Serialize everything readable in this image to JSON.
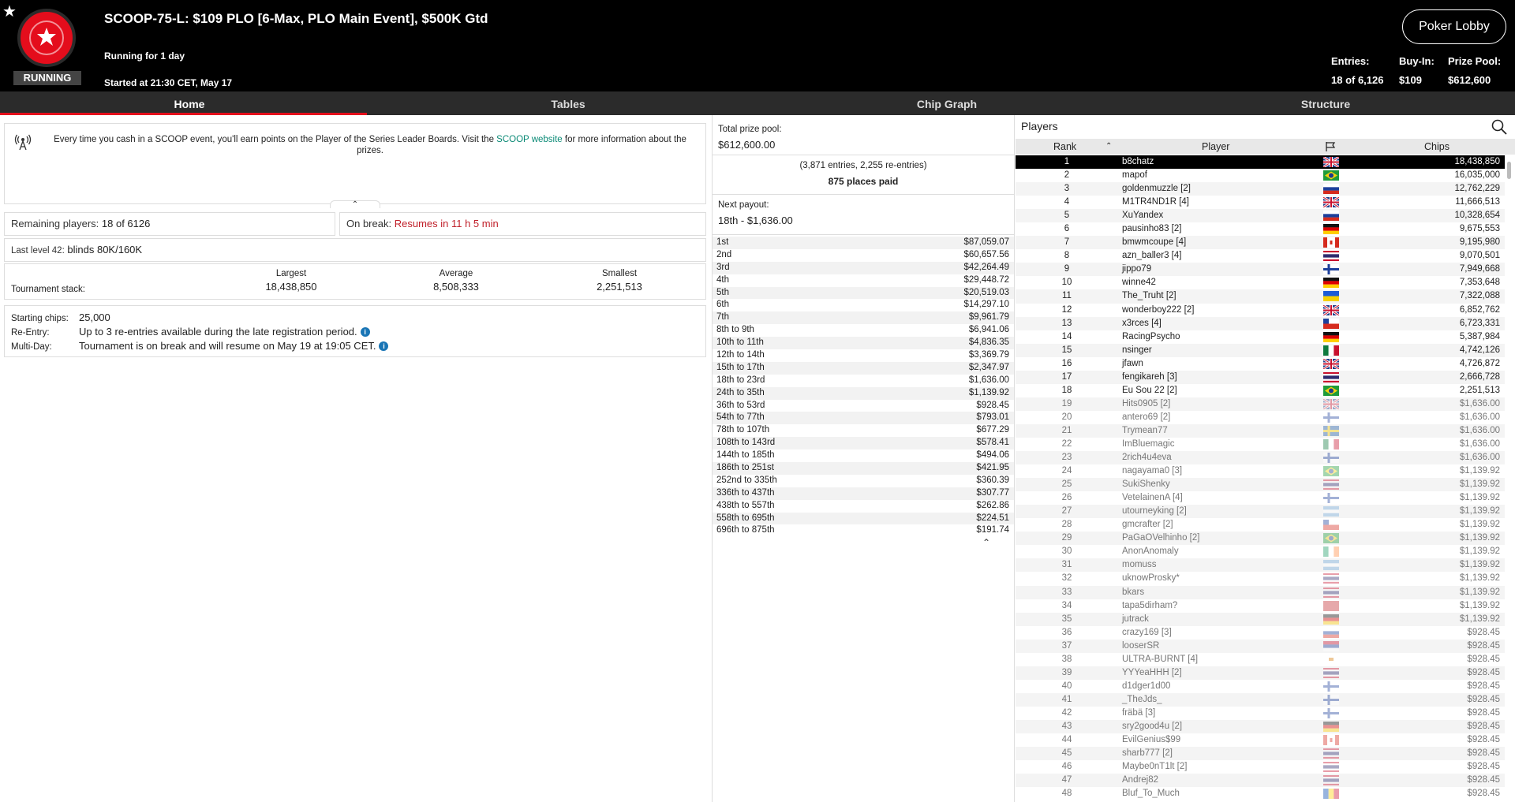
{
  "header": {
    "title": "SCOOP-75-L: $109 PLO [6-Max, PLO Main Event], $500K Gtd",
    "status_badge": "RUNNING",
    "running_for": "Running for 1 day",
    "started_at": "Started at 21:30 CET, May 17",
    "lobby_button": "Poker Lobby",
    "entries_label": "Entries:",
    "entries_value": "18 of 6,126",
    "buyin_label": "Buy-In:",
    "buyin_value": "$109",
    "prizepool_label": "Prize Pool:",
    "prizepool_value": "$612,600"
  },
  "tabs": [
    {
      "label": "Home",
      "active": true
    },
    {
      "label": "Tables",
      "active": false
    },
    {
      "label": "Chip Graph",
      "active": false
    },
    {
      "label": "Structure",
      "active": false
    }
  ],
  "home": {
    "info_text_before": "Every time you cash in a SCOOP event, you'll earn points on the Player of the Series Leader Boards. Visit the ",
    "info_link": "SCOOP website",
    "info_text_after": " for more information about the prizes.",
    "remaining_label": "Remaining players:",
    "remaining_value": "18 of 6126",
    "break_label": "On break:",
    "break_value": "Resumes in 11 h 5 min",
    "last_level_label": "Last level 42:",
    "last_level_value": "blinds 80K/160K",
    "stack_label": "Tournament stack:",
    "largest_label": "Largest",
    "largest_value": "18,438,850",
    "average_label": "Average",
    "average_value": "8,508,333",
    "smallest_label": "Smallest",
    "smallest_value": "2,251,513",
    "starting_chips_label": "Starting chips:",
    "starting_chips_value": "25,000",
    "reentry_label": "Re-Entry:",
    "reentry_value": "Up to 3 re-entries available during the late registration period.",
    "multiday_label": "Multi-Day:",
    "multiday_value": "Tournament is on break and will resume on May 19 at 19:05 CET."
  },
  "payouts": {
    "total_label": "Total prize pool:",
    "total_value": "$612,600.00",
    "entries_line": "(3,871 entries, 2,255 re-entries)",
    "places_paid": "875 places paid",
    "next_label": "Next payout:",
    "next_value": "18th - $1,636.00",
    "rows": [
      [
        "1st",
        "$87,059.07"
      ],
      [
        "2nd",
        "$60,657.56"
      ],
      [
        "3rd",
        "$42,264.49"
      ],
      [
        "4th",
        "$29,448.72"
      ],
      [
        "5th",
        "$20,519.03"
      ],
      [
        "6th",
        "$14,297.10"
      ],
      [
        "7th",
        "$9,961.79"
      ],
      [
        "8th to 9th",
        "$6,941.06"
      ],
      [
        "10th to 11th",
        "$4,836.35"
      ],
      [
        "12th to 14th",
        "$3,369.79"
      ],
      [
        "15th to 17th",
        "$2,347.97"
      ],
      [
        "18th to 23rd",
        "$1,636.00"
      ],
      [
        "24th to 35th",
        "$1,139.92"
      ],
      [
        "36th to 53rd",
        "$928.45"
      ],
      [
        "54th to 77th",
        "$793.01"
      ],
      [
        "78th to 107th",
        "$677.29"
      ],
      [
        "108th to 143rd",
        "$578.41"
      ],
      [
        "144th to 185th",
        "$494.06"
      ],
      [
        "186th to 251st",
        "$421.95"
      ],
      [
        "252nd to 335th",
        "$360.39"
      ],
      [
        "336th to 437th",
        "$307.77"
      ],
      [
        "438th to 557th",
        "$262.86"
      ],
      [
        "558th to 695th",
        "$224.51"
      ],
      [
        "696th to 875th",
        "$191.74"
      ]
    ]
  },
  "players": {
    "title": "Players",
    "col_rank": "Rank",
    "col_player": "Player",
    "col_chips": "Chips",
    "rows": [
      [
        1,
        "b8chatz",
        "uk",
        "18,438,850"
      ],
      [
        2,
        "mapof",
        "br",
        "16,035,000"
      ],
      [
        3,
        "goldenmuzzle [2]",
        "ru",
        "12,762,229"
      ],
      [
        4,
        "M1TR4ND1R [4]",
        "uk",
        "11,666,513"
      ],
      [
        5,
        "XuYandex",
        "ru",
        "10,328,654"
      ],
      [
        6,
        "pausinho83 [2]",
        "de",
        "9,675,553"
      ],
      [
        7,
        "bmwmcoupe [4]",
        "ca",
        "9,195,980"
      ],
      [
        8,
        "azn_baller3 [4]",
        "th",
        "9,070,501"
      ],
      [
        9,
        "jippo79",
        "fi",
        "7,949,668"
      ],
      [
        10,
        "winne42",
        "de",
        "7,353,648"
      ],
      [
        11,
        "The_Truht [2]",
        "ua",
        "7,322,088"
      ],
      [
        12,
        "wonderboy222 [2]",
        "uk",
        "6,852,762"
      ],
      [
        13,
        "x3rces [4]",
        "cl",
        "6,723,331"
      ],
      [
        14,
        "RacingPsycho",
        "de",
        "5,387,984"
      ],
      [
        15,
        "nsinger",
        "mx",
        "4,742,126"
      ],
      [
        16,
        "jfawn",
        "uk",
        "4,726,872"
      ],
      [
        17,
        "fengikareh [3]",
        "th",
        "2,666,728"
      ],
      [
        18,
        "Eu Sou 22 [2]",
        "br",
        "2,251,513"
      ],
      [
        19,
        "Hits0905 [2]",
        "uk",
        "$1,636.00"
      ],
      [
        20,
        "antero69 [2]",
        "fi",
        "$1,636.00"
      ],
      [
        21,
        "Trymean77",
        "se",
        "$1,636.00"
      ],
      [
        22,
        "ImBluemagic",
        "mx",
        "$1,636.00"
      ],
      [
        23,
        "2rich4u4eva",
        "fi",
        "$1,636.00"
      ],
      [
        24,
        "nagayama0 [3]",
        "br",
        "$1,139.92"
      ],
      [
        25,
        "SukiShenky",
        "th",
        "$1,139.92"
      ],
      [
        26,
        "VetelainenA [4]",
        "fi",
        "$1,139.92"
      ],
      [
        27,
        "utourneyking [2]",
        "ar",
        "$1,139.92"
      ],
      [
        28,
        "gmcrafter [2]",
        "cl",
        "$1,139.92"
      ],
      [
        29,
        "PaGaOVelhinho [2]",
        "br",
        "$1,139.92"
      ],
      [
        30,
        "AnonAnomaly",
        "ie",
        "$1,139.92"
      ],
      [
        31,
        "momuss",
        "ar",
        "$1,139.92"
      ],
      [
        32,
        "uknowProsky*",
        "th",
        "$1,139.92"
      ],
      [
        33,
        "bkars",
        "th",
        "$1,139.92"
      ],
      [
        34,
        "tapa5dirham?",
        "ma",
        "$1,139.92"
      ],
      [
        35,
        "jutrack",
        "de",
        "$1,139.92"
      ],
      [
        36,
        "crazy169 [3]",
        "sk",
        "$928.45"
      ],
      [
        37,
        "looserSR",
        "rs",
        "$928.45"
      ],
      [
        38,
        "ULTRA-BURNT [4]",
        "cy",
        "$928.45"
      ],
      [
        39,
        "YYYeaHHH [2]",
        "th",
        "$928.45"
      ],
      [
        40,
        "d1dger1d00",
        "fi",
        "$928.45"
      ],
      [
        41,
        "_TheJds_",
        "fi",
        "$928.45"
      ],
      [
        42,
        "fräbä [3]",
        "fi",
        "$928.45"
      ],
      [
        43,
        "sry2good4u [2]",
        "de",
        "$928.45"
      ],
      [
        44,
        "EvilGenius$99",
        "ca",
        "$928.45"
      ],
      [
        45,
        "sharb777 [2]",
        "th",
        "$928.45"
      ],
      [
        46,
        "Maybe0nT1lt [2]",
        "th",
        "$928.45"
      ],
      [
        47,
        "Andrej82",
        "th",
        "$928.45"
      ],
      [
        48,
        "Bluf_To_Much",
        "md",
        "$928.45"
      ]
    ]
  },
  "colors": {
    "accent_red": "#e40d1c",
    "link_green": "#0b8a76",
    "header_bg": "#000000",
    "tab_bg": "#2b2b2b"
  }
}
